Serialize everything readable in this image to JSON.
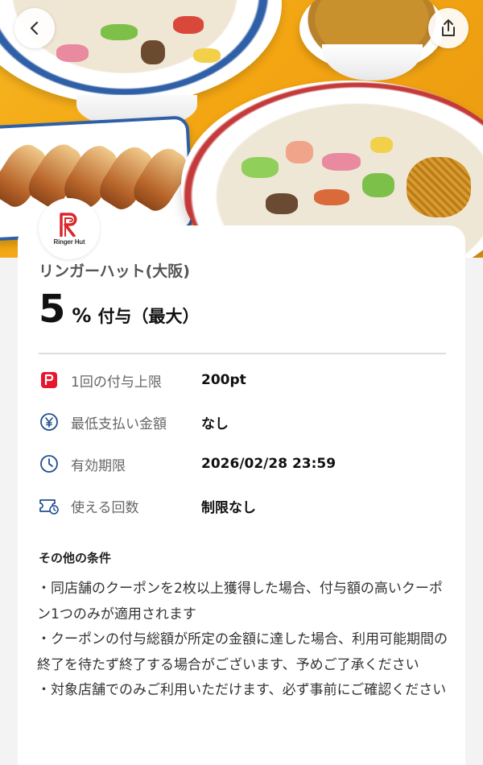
{
  "header": {
    "back_icon": "chevron-left-icon",
    "share_icon": "share-icon"
  },
  "store": {
    "logo_text": "Ringer Hut",
    "name": "リンガーハット(大阪)"
  },
  "reward": {
    "rate": "5",
    "unit": "%",
    "label": "付与（最大）"
  },
  "details": [
    {
      "icon": "paypay-icon",
      "label": "1回の付与上限",
      "value": "200pt"
    },
    {
      "icon": "yen-icon",
      "label": "最低支払い金額",
      "value": "なし"
    },
    {
      "icon": "clock-icon",
      "label": "有効期限",
      "value": "2026/02/28 23:59"
    },
    {
      "icon": "ticket-icon",
      "label": "使える回数",
      "value": "制限なし"
    }
  ],
  "conditions": {
    "title": "その他の条件",
    "items": [
      "・同店舗のクーポンを2枚以上獲得した場合、付与額の高いクーポン1つのみが適用されます",
      "・クーポンの付与総額が所定の金額に達した場合、利用可能期間の終了を待たず終了する場合がございます、予めご了承ください",
      "・対象店舗でのみご利用いただけます、必ず事前にご確認ください"
    ]
  },
  "colors": {
    "paypay_red": "#e8152f",
    "icon_blue": "#1f4f8f",
    "hero_orange": "#f3a512"
  }
}
